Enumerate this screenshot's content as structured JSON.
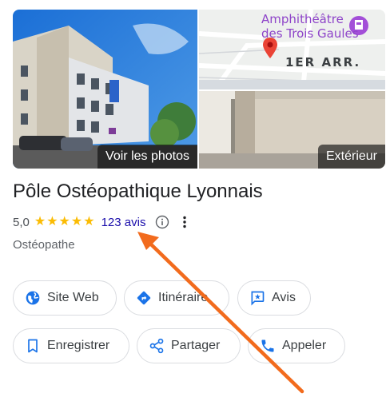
{
  "photos": {
    "main_label": "Voir les photos",
    "map": {
      "poi_line1": "Amphithéâtre",
      "poi_line2": "des Trois Gaules",
      "district": "1ER ARR."
    },
    "exterior_label": "Extérieur"
  },
  "place": {
    "name": "Pôle Ostéopathique Lyonnais",
    "rating": "5,0",
    "stars": 5,
    "reviews_link": "123 avis",
    "category": "Ostéopathe"
  },
  "actions": {
    "website": "Site Web",
    "directions": "Itinéraire",
    "review": "Avis",
    "save": "Enregistrer",
    "share": "Partager",
    "call": "Appeler"
  },
  "colors": {
    "star": "#fbbc04",
    "link": "#1a0dab",
    "icon_blue": "#1a73e8",
    "arrow": "#f26b1d",
    "map_poi": "#8e44c9",
    "map_pin": "#ea4335"
  }
}
